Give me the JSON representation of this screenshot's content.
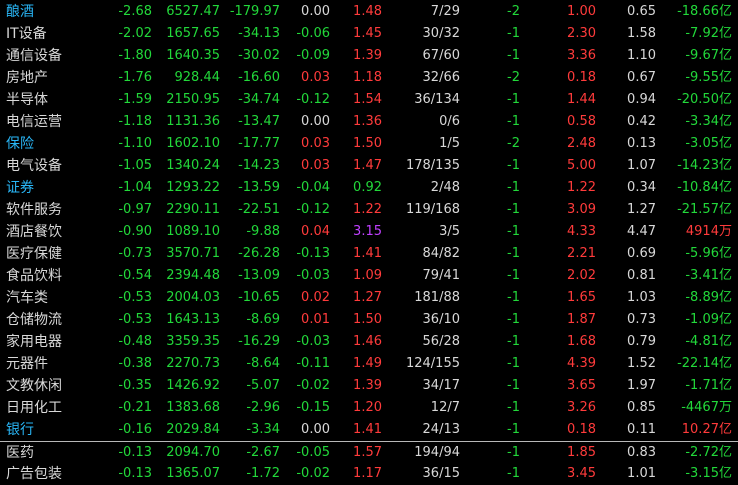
{
  "colors": {
    "up": "#ff3b3b",
    "down": "#22d83a",
    "flat": "#d8d8d8",
    "name_default": "#d8d8d8",
    "name_highlight": "#29b6f6",
    "vr_highlight": "#c040ff",
    "separator": "#b8b8b8"
  },
  "rows": [
    {
      "name": "酿酒",
      "name_hl": true,
      "pct": "-2.68",
      "price": "6527.47",
      "chg": "-179.97",
      "speed": "0.00",
      "speed_dir": "flat",
      "vr": "1.48",
      "vr_dir": "up",
      "updown": "7/29",
      "lead": "-2",
      "turnover": "1.00",
      "pe": "0.65",
      "flow": "-18.66",
      "unit": "亿",
      "flow_dir": "down"
    },
    {
      "name": "IT设备",
      "name_hl": false,
      "pct": "-2.02",
      "price": "1657.65",
      "chg": "-34.13",
      "speed": "-0.06",
      "speed_dir": "down",
      "vr": "1.45",
      "vr_dir": "up",
      "updown": "30/32",
      "lead": "-1",
      "turnover": "2.30",
      "pe": "1.58",
      "flow": "-7.92",
      "unit": "亿",
      "flow_dir": "down"
    },
    {
      "name": "通信设备",
      "name_hl": false,
      "pct": "-1.80",
      "price": "1640.35",
      "chg": "-30.02",
      "speed": "-0.09",
      "speed_dir": "down",
      "vr": "1.39",
      "vr_dir": "up",
      "updown": "67/60",
      "lead": "-1",
      "turnover": "3.36",
      "pe": "1.10",
      "flow": "-9.67",
      "unit": "亿",
      "flow_dir": "down"
    },
    {
      "name": "房地产",
      "name_hl": false,
      "pct": "-1.76",
      "price": "928.44",
      "chg": "-16.60",
      "speed": "0.03",
      "speed_dir": "up",
      "vr": "1.18",
      "vr_dir": "up",
      "updown": "32/66",
      "lead": "-2",
      "turnover": "0.18",
      "pe": "0.67",
      "flow": "-9.55",
      "unit": "亿",
      "flow_dir": "down"
    },
    {
      "name": "半导体",
      "name_hl": false,
      "pct": "-1.59",
      "price": "2150.95",
      "chg": "-34.74",
      "speed": "-0.12",
      "speed_dir": "down",
      "vr": "1.54",
      "vr_dir": "up",
      "updown": "36/134",
      "lead": "-1",
      "turnover": "1.44",
      "pe": "0.94",
      "flow": "-20.50",
      "unit": "亿",
      "flow_dir": "down"
    },
    {
      "name": "电信运营",
      "name_hl": false,
      "pct": "-1.18",
      "price": "1131.36",
      "chg": "-13.47",
      "speed": "0.00",
      "speed_dir": "flat",
      "vr": "1.36",
      "vr_dir": "up",
      "updown": "0/6",
      "lead": "-1",
      "turnover": "0.58",
      "pe": "0.42",
      "flow": "-3.34",
      "unit": "亿",
      "flow_dir": "down"
    },
    {
      "name": "保险",
      "name_hl": true,
      "pct": "-1.10",
      "price": "1602.10",
      "chg": "-17.77",
      "speed": "0.03",
      "speed_dir": "up",
      "vr": "1.50",
      "vr_dir": "up",
      "updown": "1/5",
      "lead": "-2",
      "turnover": "2.48",
      "pe": "0.13",
      "flow": "-3.05",
      "unit": "亿",
      "flow_dir": "down"
    },
    {
      "name": "电气设备",
      "name_hl": false,
      "pct": "-1.05",
      "price": "1340.24",
      "chg": "-14.23",
      "speed": "0.03",
      "speed_dir": "up",
      "vr": "1.47",
      "vr_dir": "up",
      "updown": "178/135",
      "lead": "-1",
      "turnover": "5.00",
      "pe": "1.07",
      "flow": "-14.23",
      "unit": "亿",
      "flow_dir": "down"
    },
    {
      "name": "证券",
      "name_hl": true,
      "pct": "-1.04",
      "price": "1293.22",
      "chg": "-13.59",
      "speed": "-0.04",
      "speed_dir": "down",
      "vr": "0.92",
      "vr_dir": "down",
      "updown": "2/48",
      "lead": "-1",
      "turnover": "1.22",
      "pe": "0.34",
      "flow": "-10.84",
      "unit": "亿",
      "flow_dir": "down"
    },
    {
      "name": "软件服务",
      "name_hl": false,
      "pct": "-0.97",
      "price": "2290.11",
      "chg": "-22.51",
      "speed": "-0.12",
      "speed_dir": "down",
      "vr": "1.22",
      "vr_dir": "up",
      "updown": "119/168",
      "lead": "-1",
      "turnover": "3.09",
      "pe": "1.27",
      "flow": "-21.57",
      "unit": "亿",
      "flow_dir": "down"
    },
    {
      "name": "酒店餐饮",
      "name_hl": false,
      "pct": "-0.90",
      "price": "1089.10",
      "chg": "-9.88",
      "speed": "0.04",
      "speed_dir": "up",
      "vr": "3.15",
      "vr_dir": "hl",
      "updown": "3/5",
      "lead": "-1",
      "turnover": "4.33",
      "pe": "4.47",
      "flow": "4914",
      "unit": "万",
      "flow_dir": "up"
    },
    {
      "name": "医疗保健",
      "name_hl": false,
      "pct": "-0.73",
      "price": "3570.71",
      "chg": "-26.28",
      "speed": "-0.13",
      "speed_dir": "down",
      "vr": "1.41",
      "vr_dir": "up",
      "updown": "84/82",
      "lead": "-1",
      "turnover": "2.21",
      "pe": "0.69",
      "flow": "-5.96",
      "unit": "亿",
      "flow_dir": "down"
    },
    {
      "name": "食品饮料",
      "name_hl": false,
      "pct": "-0.54",
      "price": "2394.48",
      "chg": "-13.09",
      "speed": "-0.03",
      "speed_dir": "down",
      "vr": "1.09",
      "vr_dir": "up",
      "updown": "79/41",
      "lead": "-1",
      "turnover": "2.02",
      "pe": "0.81",
      "flow": "-3.41",
      "unit": "亿",
      "flow_dir": "down"
    },
    {
      "name": "汽车类",
      "name_hl": false,
      "pct": "-0.53",
      "price": "2004.03",
      "chg": "-10.65",
      "speed": "0.02",
      "speed_dir": "up",
      "vr": "1.27",
      "vr_dir": "up",
      "updown": "181/88",
      "lead": "-1",
      "turnover": "1.65",
      "pe": "1.03",
      "flow": "-8.89",
      "unit": "亿",
      "flow_dir": "down"
    },
    {
      "name": "仓储物流",
      "name_hl": false,
      "pct": "-0.53",
      "price": "1643.13",
      "chg": "-8.69",
      "speed": "0.01",
      "speed_dir": "up",
      "vr": "1.50",
      "vr_dir": "up",
      "updown": "36/10",
      "lead": "-1",
      "turnover": "1.87",
      "pe": "0.73",
      "flow": "-1.09",
      "unit": "亿",
      "flow_dir": "down"
    },
    {
      "name": "家用电器",
      "name_hl": false,
      "pct": "-0.48",
      "price": "3359.35",
      "chg": "-16.29",
      "speed": "-0.03",
      "speed_dir": "down",
      "vr": "1.46",
      "vr_dir": "up",
      "updown": "56/28",
      "lead": "-1",
      "turnover": "1.68",
      "pe": "0.79",
      "flow": "-4.81",
      "unit": "亿",
      "flow_dir": "down"
    },
    {
      "name": "元器件",
      "name_hl": false,
      "pct": "-0.38",
      "price": "2270.73",
      "chg": "-8.64",
      "speed": "-0.11",
      "speed_dir": "down",
      "vr": "1.49",
      "vr_dir": "up",
      "updown": "124/155",
      "lead": "-1",
      "turnover": "4.39",
      "pe": "1.52",
      "flow": "-22.14",
      "unit": "亿",
      "flow_dir": "down"
    },
    {
      "name": "文教休闲",
      "name_hl": false,
      "pct": "-0.35",
      "price": "1426.92",
      "chg": "-5.07",
      "speed": "-0.02",
      "speed_dir": "down",
      "vr": "1.39",
      "vr_dir": "up",
      "updown": "34/17",
      "lead": "-1",
      "turnover": "3.65",
      "pe": "1.97",
      "flow": "-1.71",
      "unit": "亿",
      "flow_dir": "down"
    },
    {
      "name": "日用化工",
      "name_hl": false,
      "pct": "-0.21",
      "price": "1383.68",
      "chg": "-2.96",
      "speed": "-0.15",
      "speed_dir": "down",
      "vr": "1.20",
      "vr_dir": "up",
      "updown": "12/7",
      "lead": "-1",
      "turnover": "3.26",
      "pe": "0.85",
      "flow": "-4467",
      "unit": "万",
      "flow_dir": "down"
    },
    {
      "name": "银行",
      "name_hl": true,
      "pct": "-0.16",
      "price": "2029.84",
      "chg": "-3.34",
      "speed": "0.00",
      "speed_dir": "flat",
      "vr": "1.41",
      "vr_dir": "up",
      "updown": "24/13",
      "lead": "-1",
      "turnover": "0.18",
      "pe": "0.11",
      "flow": "10.27",
      "unit": "亿",
      "flow_dir": "up"
    },
    {
      "name": "医药",
      "name_hl": false,
      "pct": "-0.13",
      "price": "2094.70",
      "chg": "-2.67",
      "speed": "-0.05",
      "speed_dir": "down",
      "vr": "1.57",
      "vr_dir": "up",
      "updown": "194/94",
      "lead": "-1",
      "turnover": "1.85",
      "pe": "0.83",
      "flow": "-2.72",
      "unit": "亿",
      "flow_dir": "down",
      "separator": true
    },
    {
      "name": "广告包装",
      "name_hl": false,
      "pct": "-0.13",
      "price": "1365.07",
      "chg": "-1.72",
      "speed": "-0.02",
      "speed_dir": "down",
      "vr": "1.17",
      "vr_dir": "up",
      "updown": "36/15",
      "lead": "-1",
      "turnover": "3.45",
      "pe": "1.01",
      "flow": "-3.15",
      "unit": "亿",
      "flow_dir": "down"
    }
  ]
}
